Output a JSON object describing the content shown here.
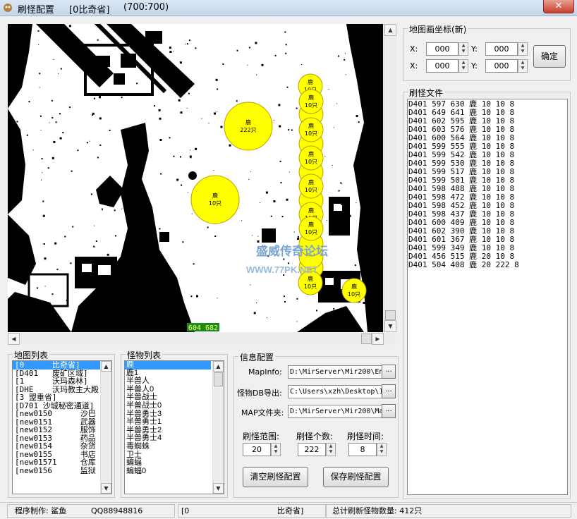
{
  "window": {
    "title": "刷怪配置",
    "map": "[0比奇省]",
    "size": "(700:700)",
    "close_label": "✕"
  },
  "map": {
    "coord_readout": "604 682",
    "watermark_title": "盛威传奇论坛",
    "watermark_url": "WWW.77PK.NET",
    "markers": [
      {
        "name": "鹿",
        "count": "222只"
      },
      {
        "name": "鹿",
        "count": "10只"
      },
      {
        "name": "鹿",
        "count": "10只"
      },
      {
        "name": "鹿",
        "count": "10只"
      },
      {
        "name": "鹿",
        "count": "10只"
      },
      {
        "name": "鹿",
        "count": "10只"
      },
      {
        "name": "鹿",
        "count": "10只"
      },
      {
        "name": "鹿",
        "count": "10只"
      },
      {
        "name": "鹿",
        "count": "10只"
      },
      {
        "name": "鹿",
        "count": "10只"
      },
      {
        "name": "鹿",
        "count": "10只"
      }
    ]
  },
  "coords": {
    "title": "地图画坐标(新)",
    "x_label": "X:",
    "y_label": "Y:",
    "x1": "000",
    "y1": "000",
    "x2": "000",
    "y2": "000",
    "confirm_label": "确定"
  },
  "spawn_file": {
    "title": "刷怪文件",
    "lines": [
      "D401 597 630 鹿 10 10 8",
      "D401 649 641 鹿 10 10 8",
      "D401 602 595 鹿 10 10 8",
      "D401 603 576 鹿 10 10 8",
      "D401 600 564 鹿 10 10 8",
      "D401 599 555 鹿 10 10 8",
      "D401 599 542 鹿 10 10 8",
      "D401 599 530 鹿 10 10 8",
      "D401 599 517 鹿 10 10 8",
      "D401 599 501 鹿 10 10 8",
      "D401 598 488 鹿 10 10 8",
      "D401 598 472 鹿 10 10 8",
      "D401 598 452 鹿 10 10 8",
      "D401 598 437 鹿 10 10 8",
      "D401 600 409 鹿 10 10 8",
      "D401 602 390 鹿 10 10 8",
      "D401 601 367 鹿 10 10 8",
      "D401 599 349 鹿 10 10 8",
      "D401 456 515 鹿 20 10 8",
      "D401 504 408 鹿 20 222 8"
    ]
  },
  "map_list": {
    "title": "地图列表",
    "items": [
      "[0      比奇省]",
      "[D401   废矿区域]",
      "[1      沃玛森林]",
      "[DHE    沃玛教主大殿",
      "[3 盟重省]",
      "[D701 沙城秘密通道]",
      "[new0150      沙巴",
      "[new0151      武器",
      "[new0152      服饰",
      "[new0153      药品",
      "[new0154      杂货",
      "[new0155      书店",
      "[new01571     仓库",
      "[new0156      监狱"
    ]
  },
  "monster_list": {
    "title": "怪物列表",
    "items": [
      "鹿",
      "鹿1",
      "半兽人",
      "半兽人0",
      "半兽战士",
      "半兽战士0",
      "半兽勇士3",
      "半兽勇士1",
      "半兽勇士2",
      "半兽勇士4",
      "毒蜘蛛",
      "卫士",
      "蝙蝠",
      "蝙蝠0"
    ]
  },
  "info": {
    "title": "信息配置",
    "mapinfo_label": "MapInfo:",
    "mapinfo_value": "D:\\MirServer\\Mir200\\Envir",
    "db_label": "怪物DB导出:",
    "db_value": "C:\\Users\\xzh\\Desktop\\1",
    "map_label": "MAP文件夹:",
    "map_value": "D:\\MirServer\\Mir200\\Map",
    "browse_label": "...",
    "range_label": "刷怪范围:",
    "range_value": "20",
    "count_label": "刷怪个数:",
    "count_value": "222",
    "time_label": "刷怪时间:",
    "time_value": "8",
    "clear_label": "清空刷怪配置",
    "save_label": "保存刷怪配置"
  },
  "status": {
    "author": "程序制作: 鲨鱼",
    "qq": "QQ88948816",
    "map_left": "[0",
    "map_right": "比奇省]",
    "total": "总计刷新怪物数量: 412只"
  },
  "colors": {
    "marker_fill": "#ffff00",
    "marker_stroke": "#b8a000",
    "selection": "#3399ff",
    "coord_bg": "#1d8a1d",
    "coord_fg": "#ffff66"
  }
}
